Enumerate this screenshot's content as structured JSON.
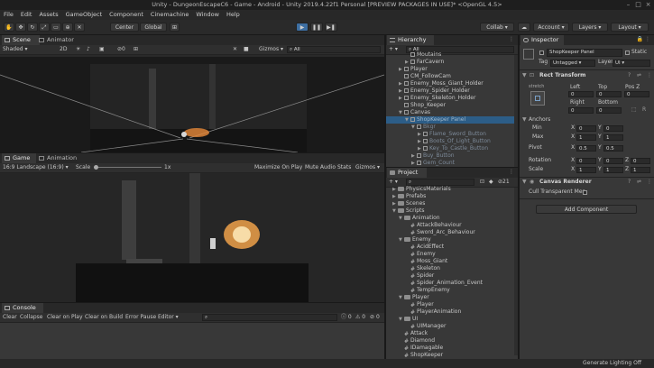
{
  "window": {
    "title": "Unity - DungeonEscapeC6 - Game - Android - Unity 2019.4.22f1 Personal [PREVIEW PACKAGES IN USE]* <OpenGL 4.5>"
  },
  "menu": [
    "File",
    "Edit",
    "Assets",
    "GameObject",
    "Component",
    "Cinemachine",
    "Window",
    "Help"
  ],
  "toolbar": {
    "pivot": "Center",
    "space": "Global",
    "collab": "Collab",
    "account": "Account",
    "layers": "Layers",
    "layout": "Layout"
  },
  "scene": {
    "tabs": [
      "Scene",
      "Animator"
    ],
    "shading": "Shaded",
    "mode2d": "2D",
    "gizmos": "Gizmos",
    "search_placeholder": "All",
    "count": "0"
  },
  "game": {
    "tabs": [
      "Game",
      "Animation"
    ],
    "resolution": "16:9 Landscape (16:9)",
    "scale_label": "Scale",
    "scale_value": "1x",
    "buttons": [
      "Maximize On Play",
      "Mute Audio",
      "Stats",
      "Gizmos"
    ]
  },
  "console": {
    "tab": "Console",
    "buttons": [
      "Clear",
      "Collapse",
      "Clear on Play",
      "Clear on Build",
      "Error Pause",
      "Editor"
    ],
    "counts": {
      "info": "0",
      "warn": "0",
      "error": "0"
    }
  },
  "hierarchy": {
    "tab": "Hierarchy",
    "search_placeholder": "All",
    "items": [
      {
        "label": "Moutains",
        "depth": 3,
        "arrow": "",
        "state": "normal"
      },
      {
        "label": "FarCavern",
        "depth": 3,
        "arrow": "▶",
        "state": "normal"
      },
      {
        "label": "Player",
        "depth": 2,
        "arrow": "▶",
        "state": "normal"
      },
      {
        "label": "CM_FollowCam",
        "depth": 2,
        "arrow": "",
        "state": "normal"
      },
      {
        "label": "Enemy_Moss_Giant_Holder",
        "depth": 2,
        "arrow": "▶",
        "state": "normal"
      },
      {
        "label": "Enemy_Spider_Holder",
        "depth": 2,
        "arrow": "▶",
        "state": "normal"
      },
      {
        "label": "Enemy_Skeleton_Holder",
        "depth": 2,
        "arrow": "▶",
        "state": "normal"
      },
      {
        "label": "Shop_Keeper",
        "depth": 2,
        "arrow": "",
        "state": "normal"
      },
      {
        "label": "Canvas",
        "depth": 2,
        "arrow": "▼",
        "state": "normal"
      },
      {
        "label": "ShopKeeper Panel",
        "depth": 3,
        "arrow": "▼",
        "state": "selected"
      },
      {
        "label": "Bkgr",
        "depth": 4,
        "arrow": "▼",
        "state": "dim"
      },
      {
        "label": "Flame_Sword_Button",
        "depth": 5,
        "arrow": "▶",
        "state": "dim"
      },
      {
        "label": "Boots_Of_Light_Button",
        "depth": 5,
        "arrow": "▶",
        "state": "dim"
      },
      {
        "label": "Key_To_Castle_Button",
        "depth": 5,
        "arrow": "▶",
        "state": "dim"
      },
      {
        "label": "Buy_Button",
        "depth": 4,
        "arrow": "▶",
        "state": "dim"
      },
      {
        "label": "Gem_Count",
        "depth": 4,
        "arrow": "▶",
        "state": "dim"
      }
    ]
  },
  "project": {
    "tab": "Project",
    "badge": "21",
    "items": [
      {
        "label": "PhysicsMaterials",
        "depth": 1,
        "arrow": "▶",
        "kind": "folder"
      },
      {
        "label": "Prefabs",
        "depth": 1,
        "arrow": "▶",
        "kind": "folder"
      },
      {
        "label": "Scenes",
        "depth": 1,
        "arrow": "▶",
        "kind": "folder"
      },
      {
        "label": "Scripts",
        "depth": 1,
        "arrow": "▼",
        "kind": "folder"
      },
      {
        "label": "Animation",
        "depth": 2,
        "arrow": "▼",
        "kind": "folder"
      },
      {
        "label": "AttackBehaviour",
        "depth": 3,
        "arrow": "",
        "kind": "script"
      },
      {
        "label": "Sword_Arc_Behaviour",
        "depth": 3,
        "arrow": "",
        "kind": "script"
      },
      {
        "label": "Enemy",
        "depth": 2,
        "arrow": "▼",
        "kind": "folder"
      },
      {
        "label": "AcidEffect",
        "depth": 3,
        "arrow": "",
        "kind": "script"
      },
      {
        "label": "Enemy",
        "depth": 3,
        "arrow": "",
        "kind": "script"
      },
      {
        "label": "Moss_Giant",
        "depth": 3,
        "arrow": "",
        "kind": "script"
      },
      {
        "label": "Skeleton",
        "depth": 3,
        "arrow": "",
        "kind": "script"
      },
      {
        "label": "Spider",
        "depth": 3,
        "arrow": "",
        "kind": "script"
      },
      {
        "label": "Spider_Animation_Event",
        "depth": 3,
        "arrow": "",
        "kind": "script"
      },
      {
        "label": "TempEnemy",
        "depth": 3,
        "arrow": "",
        "kind": "script"
      },
      {
        "label": "Player",
        "depth": 2,
        "arrow": "▼",
        "kind": "folder"
      },
      {
        "label": "Player",
        "depth": 3,
        "arrow": "",
        "kind": "script"
      },
      {
        "label": "PlayerAnimation",
        "depth": 3,
        "arrow": "",
        "kind": "script"
      },
      {
        "label": "UI",
        "depth": 2,
        "arrow": "▼",
        "kind": "folder"
      },
      {
        "label": "UIManager",
        "depth": 3,
        "arrow": "",
        "kind": "script"
      },
      {
        "label": "Attack",
        "depth": 2,
        "arrow": "",
        "kind": "script"
      },
      {
        "label": "Diamond",
        "depth": 2,
        "arrow": "",
        "kind": "script"
      },
      {
        "label": "IDamagable",
        "depth": 2,
        "arrow": "",
        "kind": "script"
      },
      {
        "label": "ShopKeeper",
        "depth": 2,
        "arrow": "",
        "kind": "script"
      }
    ]
  },
  "inspector": {
    "tab": "Inspector",
    "object_name": "ShopKeeper Panel",
    "static_label": "Static",
    "tag_label": "Tag",
    "tag_value": "Untagged",
    "layer_label": "Layer",
    "layer_value": "UI",
    "rect_transform": {
      "title": "Rect Transform",
      "anchor_preset": "stretch",
      "headers": [
        "Left",
        "Top",
        "Pos Z"
      ],
      "values": [
        "0",
        "0",
        "0"
      ],
      "headers2": [
        "Right",
        "Bottom"
      ],
      "values2": [
        "0",
        "0"
      ],
      "anchors_label": "Anchors",
      "min_label": "Min",
      "min": [
        "0",
        "0"
      ],
      "max_label": "Max",
      "max": [
        "1",
        "1"
      ],
      "pivot_label": "Pivot",
      "pivot": [
        "0.5",
        "0.5"
      ],
      "rotation_label": "Rotation",
      "rotation": [
        "0",
        "0",
        "0"
      ],
      "scale_label": "Scale",
      "scale": [
        "1",
        "1",
        "1"
      ],
      "axis": [
        "X",
        "Y",
        "Z"
      ]
    },
    "canvas_renderer": {
      "title": "Canvas Renderer",
      "cull_label": "Cull Transparent Mes"
    },
    "add_component": "Add Component"
  },
  "status": {
    "message": "Generate Lighting Off"
  }
}
